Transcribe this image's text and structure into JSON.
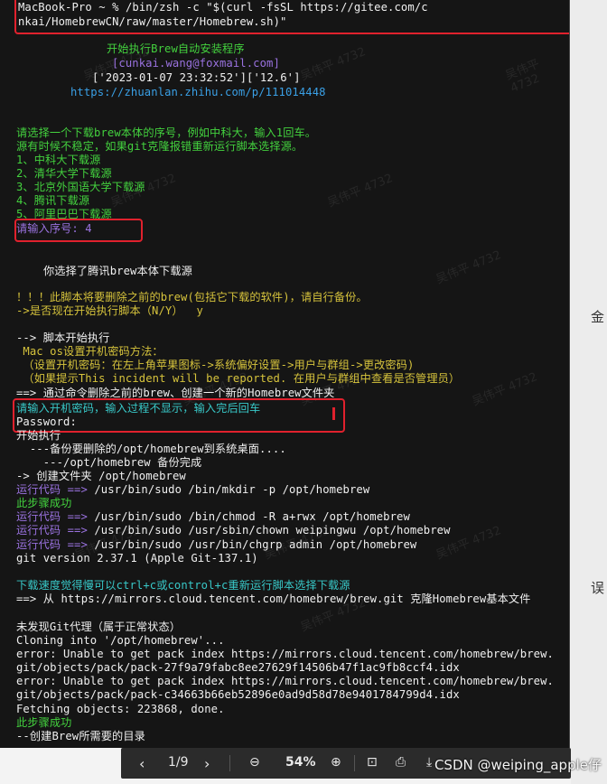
{
  "terminal": {
    "header": [
      "MacBook-Pro ~ % /bin/zsh -c \"$(curl -fsSL https://gitee.com/c",
      "nkai/HomebrewCN/raw/master/Homebrew.sh)\""
    ],
    "intro": [
      "开始执行Brew自动安装程序",
      "[cunkai.wang@foxmail.com]",
      "['2023-01-07 23:32:52']['12.6']",
      "https://zhuanlan.zhihu.com/p/111014448"
    ],
    "source_prompt": [
      "请选择一个下载brew本体的序号，例如中科大，输入1回车。",
      "源有时候不稳定，如果git克隆报错重新运行脚本选择源。",
      "1、中科大下载源",
      "2、清华大学下载源",
      "3、北京外国语大学下载源",
      "4、腾讯下载源",
      "5、阿里巴巴下载源"
    ],
    "input_number": "请输入序号: 4",
    "chosen": "你选择了腾讯brew本体下载源",
    "warning": [
      "！！！此脚本将要删除之前的brew(包括它下载的软件)，请自行备份。",
      "->是否现在开始执行脚本（N/Y）  y"
    ],
    "run": [
      "--> 脚本开始执行",
      " Mac os设置开机密码方法：",
      " （设置开机密码：在左上角苹果图标->系统偏好设置->用户与群组->更改密码)",
      " （如果提示This incident will be reported. 在用户与群组中查看是否管理员）",
      "==> 通过命令删除之前的brew、创建一个新的Homebrew文件夹"
    ],
    "password_prompt": "请输入开机密码，输入过程不显示，输入完后回车",
    "password_label": "Password:",
    "exec": [
      "开始执行",
      "  ---备份要删除的/opt/homebrew到系统桌面....",
      "    ---/opt/homebrew 备份完成",
      "-> 创建文件夹 /opt/homebrew"
    ],
    "cmd_prefix": "运行代码 ==>",
    "cmds": [
      " /usr/bin/sudo /bin/mkdir -p /opt/homebrew",
      " /usr/bin/sudo /bin/chmod -R a+rwx /opt/homebrew",
      " /usr/bin/sudo /usr/sbin/chown weipingwu /opt/homebrew",
      " /usr/bin/sudo /usr/bin/chgrp admin /opt/homebrew"
    ],
    "success": "此步骤成功",
    "git_version": "git version 2.37.1 (Apple Git-137.1)",
    "slow_hint": "下载速度觉得慢可以ctrl+c或control+c重新运行脚本选择下载源",
    "clone_from": "==> 从 https://mirrors.cloud.tencent.com/homebrew/brew.git 克隆Homebrew基本文件",
    "tail": [
      "未发现Git代理（属于正常状态）",
      "Cloning into '/opt/homebrew'...",
      "error: Unable to get pack index https://mirrors.cloud.tencent.com/homebrew/brew.",
      "git/objects/pack/pack-27f9a79fabc8ee27629f14506b47f1ac9fb8ccf4.idx",
      "error: Unable to get pack index https://mirrors.cloud.tencent.com/homebrew/brew.",
      "git/objects/pack/pack-c34663b66eb52896e0ad9d58d78e9401784799d4.idx",
      "Fetching objects: 223868, done."
    ],
    "final_success": "此步骤成功",
    "last_line": "--创建Brew所需要的目录",
    "watermark": "吴伟平 4732"
  },
  "pdf_toolbar": {
    "page": "1/9",
    "zoom": "54%",
    "prev_icon": "chevron-left-icon",
    "next_icon": "chevron-right-icon"
  },
  "credit": "CSDN @weiping_apple仔",
  "side_fragments": [
    "金",
    "误"
  ]
}
